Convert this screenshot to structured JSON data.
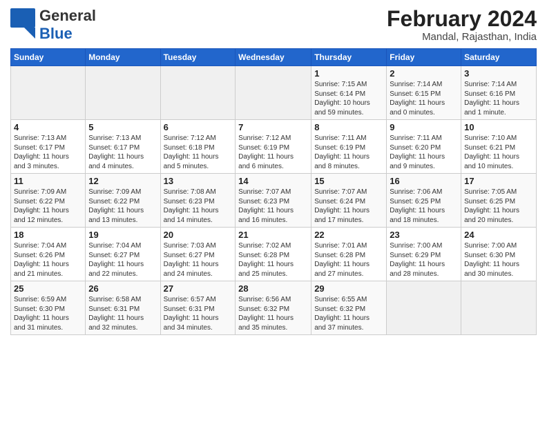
{
  "header": {
    "logo_general": "General",
    "logo_blue": "Blue",
    "month_title": "February 2024",
    "location": "Mandal, Rajasthan, India"
  },
  "weekdays": [
    "Sunday",
    "Monday",
    "Tuesday",
    "Wednesday",
    "Thursday",
    "Friday",
    "Saturday"
  ],
  "weeks": [
    [
      {
        "day": "",
        "info": ""
      },
      {
        "day": "",
        "info": ""
      },
      {
        "day": "",
        "info": ""
      },
      {
        "day": "",
        "info": ""
      },
      {
        "day": "1",
        "info": "Sunrise: 7:15 AM\nSunset: 6:14 PM\nDaylight: 10 hours\nand 59 minutes."
      },
      {
        "day": "2",
        "info": "Sunrise: 7:14 AM\nSunset: 6:15 PM\nDaylight: 11 hours\nand 0 minutes."
      },
      {
        "day": "3",
        "info": "Sunrise: 7:14 AM\nSunset: 6:16 PM\nDaylight: 11 hours\nand 1 minute."
      }
    ],
    [
      {
        "day": "4",
        "info": "Sunrise: 7:13 AM\nSunset: 6:17 PM\nDaylight: 11 hours\nand 3 minutes."
      },
      {
        "day": "5",
        "info": "Sunrise: 7:13 AM\nSunset: 6:17 PM\nDaylight: 11 hours\nand 4 minutes."
      },
      {
        "day": "6",
        "info": "Sunrise: 7:12 AM\nSunset: 6:18 PM\nDaylight: 11 hours\nand 5 minutes."
      },
      {
        "day": "7",
        "info": "Sunrise: 7:12 AM\nSunset: 6:19 PM\nDaylight: 11 hours\nand 6 minutes."
      },
      {
        "day": "8",
        "info": "Sunrise: 7:11 AM\nSunset: 6:19 PM\nDaylight: 11 hours\nand 8 minutes."
      },
      {
        "day": "9",
        "info": "Sunrise: 7:11 AM\nSunset: 6:20 PM\nDaylight: 11 hours\nand 9 minutes."
      },
      {
        "day": "10",
        "info": "Sunrise: 7:10 AM\nSunset: 6:21 PM\nDaylight: 11 hours\nand 10 minutes."
      }
    ],
    [
      {
        "day": "11",
        "info": "Sunrise: 7:09 AM\nSunset: 6:22 PM\nDaylight: 11 hours\nand 12 minutes."
      },
      {
        "day": "12",
        "info": "Sunrise: 7:09 AM\nSunset: 6:22 PM\nDaylight: 11 hours\nand 13 minutes."
      },
      {
        "day": "13",
        "info": "Sunrise: 7:08 AM\nSunset: 6:23 PM\nDaylight: 11 hours\nand 14 minutes."
      },
      {
        "day": "14",
        "info": "Sunrise: 7:07 AM\nSunset: 6:23 PM\nDaylight: 11 hours\nand 16 minutes."
      },
      {
        "day": "15",
        "info": "Sunrise: 7:07 AM\nSunset: 6:24 PM\nDaylight: 11 hours\nand 17 minutes."
      },
      {
        "day": "16",
        "info": "Sunrise: 7:06 AM\nSunset: 6:25 PM\nDaylight: 11 hours\nand 18 minutes."
      },
      {
        "day": "17",
        "info": "Sunrise: 7:05 AM\nSunset: 6:25 PM\nDaylight: 11 hours\nand 20 minutes."
      }
    ],
    [
      {
        "day": "18",
        "info": "Sunrise: 7:04 AM\nSunset: 6:26 PM\nDaylight: 11 hours\nand 21 minutes."
      },
      {
        "day": "19",
        "info": "Sunrise: 7:04 AM\nSunset: 6:27 PM\nDaylight: 11 hours\nand 22 minutes."
      },
      {
        "day": "20",
        "info": "Sunrise: 7:03 AM\nSunset: 6:27 PM\nDaylight: 11 hours\nand 24 minutes."
      },
      {
        "day": "21",
        "info": "Sunrise: 7:02 AM\nSunset: 6:28 PM\nDaylight: 11 hours\nand 25 minutes."
      },
      {
        "day": "22",
        "info": "Sunrise: 7:01 AM\nSunset: 6:28 PM\nDaylight: 11 hours\nand 27 minutes."
      },
      {
        "day": "23",
        "info": "Sunrise: 7:00 AM\nSunset: 6:29 PM\nDaylight: 11 hours\nand 28 minutes."
      },
      {
        "day": "24",
        "info": "Sunrise: 7:00 AM\nSunset: 6:30 PM\nDaylight: 11 hours\nand 30 minutes."
      }
    ],
    [
      {
        "day": "25",
        "info": "Sunrise: 6:59 AM\nSunset: 6:30 PM\nDaylight: 11 hours\nand 31 minutes."
      },
      {
        "day": "26",
        "info": "Sunrise: 6:58 AM\nSunset: 6:31 PM\nDaylight: 11 hours\nand 32 minutes."
      },
      {
        "day": "27",
        "info": "Sunrise: 6:57 AM\nSunset: 6:31 PM\nDaylight: 11 hours\nand 34 minutes."
      },
      {
        "day": "28",
        "info": "Sunrise: 6:56 AM\nSunset: 6:32 PM\nDaylight: 11 hours\nand 35 minutes."
      },
      {
        "day": "29",
        "info": "Sunrise: 6:55 AM\nSunset: 6:32 PM\nDaylight: 11 hours\nand 37 minutes."
      },
      {
        "day": "",
        "info": ""
      },
      {
        "day": "",
        "info": ""
      }
    ]
  ]
}
